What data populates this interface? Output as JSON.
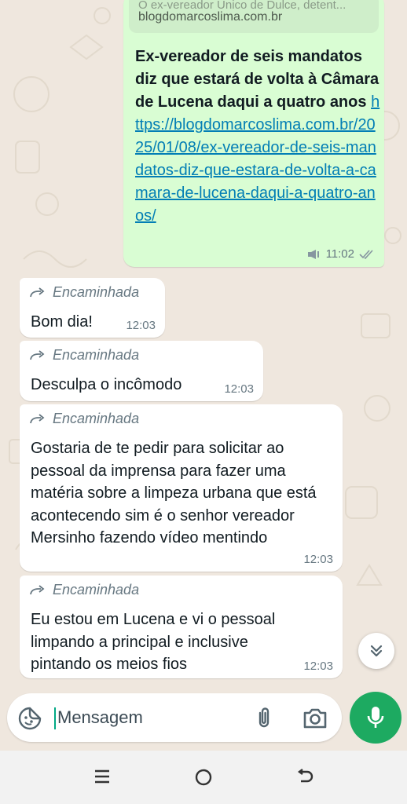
{
  "link_message": {
    "preview_description": "O ex-vereador Unico de Dulce, detent...",
    "preview_domain": "blogdomarcoslima.com.br",
    "headline": "Ex-vereador de seis mandatos diz que estará de volta à Câmara de Lucena daqui a quatro anos",
    "url": "https://blogdomarcoslima.com.br/2025/01/08/ex-vereador-de-seis-mandatos-diz-que-estara-de-volta-a-camara-de-lucena-daqui-a-quatro-anos/",
    "time": "11:02"
  },
  "forwarded_label": "Encaminhada",
  "messages": [
    {
      "text": "Bom dia!",
      "time": "12:03"
    },
    {
      "text": "Desculpa o incômodo",
      "time": "12:03"
    },
    {
      "text": "Gostaria de te pedir para solicitar ao pessoal da imprensa para fazer uma matéria sobre a limpeza urbana que está acontecendo sim é o senhor vereador Mersinho fazendo vídeo mentindo",
      "time": "12:03"
    },
    {
      "text": "Eu estou em Lucena e vi o pessoal limpando a principal e inclusive pintando os meios fios",
      "time": "12:03"
    }
  ],
  "composer": {
    "placeholder": "Mensagem"
  },
  "colors": {
    "accent": "#1daa61",
    "outgoing": "#d9fdd3",
    "link": "#027eb5",
    "background": "#efe7de"
  },
  "icons": {
    "forward": "forward-arrow-icon",
    "sticker": "sticker-icon",
    "attach": "paperclip-icon",
    "camera": "camera-icon",
    "mic": "mic-icon",
    "scroll": "double-chevron-down-icon",
    "read": "double-check-icon",
    "speaker": "speaker-icon"
  }
}
